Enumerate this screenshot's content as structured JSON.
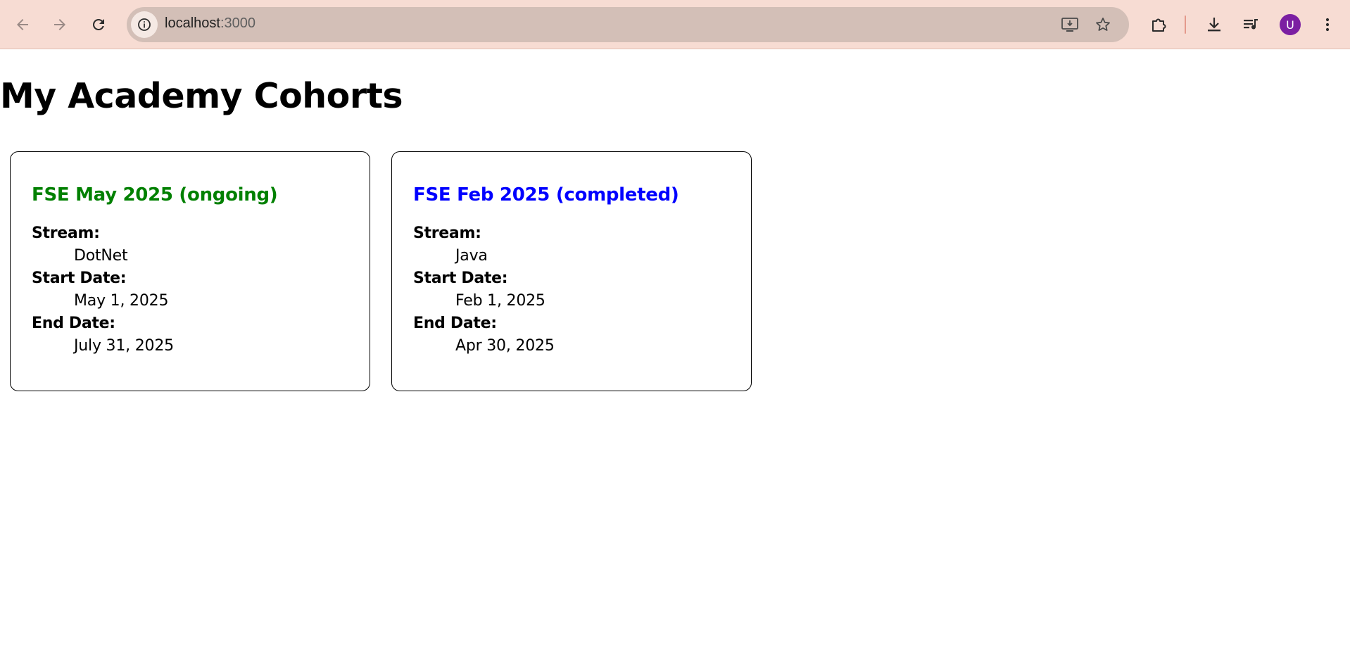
{
  "browser": {
    "url_host": "localhost",
    "url_port": ":3000",
    "avatar_initial": "U"
  },
  "page": {
    "title": "My Academy Cohorts"
  },
  "cohorts": [
    {
      "title": "FSE May 2025 (ongoing)",
      "title_color": "#008000",
      "stream_label": "Stream:",
      "stream": "DotNet",
      "start_label": "Start Date:",
      "start_date": "May 1, 2025",
      "end_label": "End Date:",
      "end_date": "July 31, 2025"
    },
    {
      "title": "FSE Feb 2025 (completed)",
      "title_color": "#0000ff",
      "stream_label": "Stream:",
      "stream": "Java",
      "start_label": "Start Date:",
      "start_date": "Feb 1, 2025",
      "end_label": "End Date:",
      "end_date": "Apr 30, 2025"
    }
  ],
  "icons": {
    "back": "back-arrow-icon",
    "forward": "forward-arrow-icon",
    "reload": "reload-icon",
    "site_info": "info-icon",
    "install": "install-app-icon",
    "bookmark": "star-icon",
    "extensions": "puzzle-icon",
    "downloads": "download-icon",
    "media": "media-queue-icon",
    "menu": "kebab-menu-icon"
  }
}
